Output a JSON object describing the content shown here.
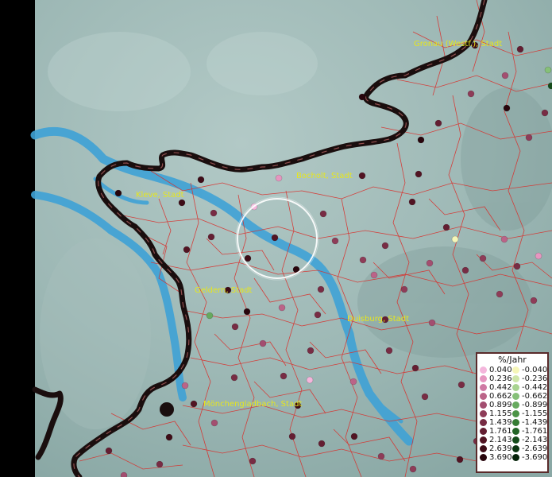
{
  "cities": [
    {
      "name": "Gronau (Westf.), Stadt",
      "data_name": "city-label-gronau"
    },
    {
      "name": "Bocholt, Stadt",
      "data_name": "city-label-bocholt"
    },
    {
      "name": "Kleve, Stadt",
      "data_name": "city-label-kleve"
    },
    {
      "name": "Geldern, Stadt",
      "data_name": "city-label-geldern"
    },
    {
      "name": "Duisburg, Stadt",
      "data_name": "city-label-duisburg"
    },
    {
      "name": "Mönchengladbach, Stadt",
      "data_name": "city-label-moenchengladbach"
    }
  ],
  "legend": {
    "title": "%/Jahr",
    "positive": [
      {
        "value": "0.040",
        "color": "#f4b6dc"
      },
      {
        "value": "0.236",
        "color": "#e696c0"
      },
      {
        "value": "0.442",
        "color": "#cf7aa4"
      },
      {
        "value": "0.662",
        "color": "#bb6488"
      },
      {
        "value": "0.899",
        "color": "#a34e70"
      },
      {
        "value": "1.155",
        "color": "#8e3c58"
      },
      {
        "value": "1.439",
        "color": "#782c44"
      },
      {
        "value": "1.761",
        "color": "#641e32"
      },
      {
        "value": "2.143",
        "color": "#521423"
      },
      {
        "value": "2.639",
        "color": "#3e0c17"
      },
      {
        "value": "3.690",
        "color": "#28050c"
      }
    ],
    "negative": [
      {
        "value": "-0.040",
        "color": "#f6f6b8"
      },
      {
        "value": "-0.236",
        "color": "#cfe6a8"
      },
      {
        "value": "-0.442",
        "color": "#a9d490"
      },
      {
        "value": "-0.662",
        "color": "#86c078"
      },
      {
        "value": "-0.899",
        "color": "#66aa5e"
      },
      {
        "value": "-1.155",
        "color": "#4c9446"
      },
      {
        "value": "-1.439",
        "color": "#367c34"
      },
      {
        "value": "-1.761",
        "color": "#236426"
      },
      {
        "value": "-2.143",
        "color": "#154c1a"
      },
      {
        "value": "-2.639",
        "color": "#0b3610"
      },
      {
        "value": "-3.690",
        "color": "#042208"
      }
    ]
  },
  "colors": {
    "terrain": "#9db8b5",
    "river": "#3fa2d6",
    "boundary": "#d8322e",
    "border": "#1a0e0e",
    "label": "#e6e61e"
  }
}
